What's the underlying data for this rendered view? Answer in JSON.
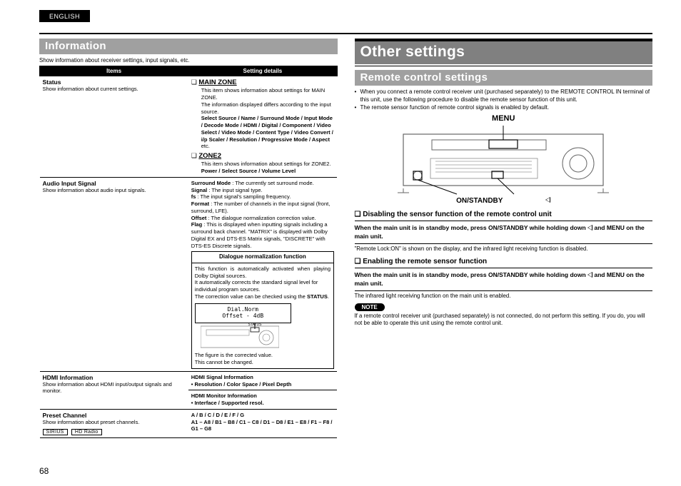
{
  "lang_tab": "ENGLISH",
  "page_number": "68",
  "left": {
    "heading": "Information",
    "intro": "Show information about receiver settings, input signals, etc.",
    "table_head": {
      "col1": "Items",
      "col2": "Setting details"
    },
    "rows": {
      "status": {
        "name": "Status",
        "desc": "Show information about current settings.",
        "mainzone_title": "MAIN ZONE",
        "mainzone_text1": "This item shows information about settings for MAIN ZONE.",
        "mainzone_text2": "The information displayed differs according to the input source.",
        "mainzone_bold": "Select Source / Name / Surround Mode / Input Mode / Decode Mode / HDMI / Digital / Component / Video Select / Video Mode / Content Type / Video Convert / i/p Scaler / Resolution / Progressive Mode / Aspect",
        "mainzone_etc": " etc.",
        "zone2_title": "ZONE2",
        "zone2_text": "This item shows information about settings for ZONE2.",
        "zone2_bold": "Power / Select Source / Volume Level"
      },
      "audio": {
        "name": "Audio Input Signal",
        "desc": "Show information about audio input signals.",
        "l_surround": "Surround Mode",
        "t_surround": " : The currently set surround mode.",
        "l_signal": "Signal",
        "t_signal": " : The input signal type.",
        "l_fs": "fs",
        "t_fs": " : The input signal's sampling frequency.",
        "l_format": "Format",
        "t_format": " : The number of channels in the input signal (front, surround, LFE).",
        "l_offset": "Offset",
        "t_offset": " : The dialogue normalization correction value.",
        "l_flag": "Flag",
        "t_flag": " : This is displayed when inputting signals including a surround back channel. \"MATRIX\" is displayed with Dolby Digital EX and DTS-ES Matrix signals, \"DISCRETE\" with DTS-ES Discrete signals.",
        "dnf_title": "Dialogue normalization function",
        "dnf_p1": "This function is automatically activated when playing Dolby Digital sources.",
        "dnf_p2": "It automatically corrects the standard signal level for individual program sources.",
        "dnf_p3a": "The correction value can be checked using the ",
        "dnf_p3b": "STATUS",
        "dnf_p3c": ".",
        "display_l1": "Dial.Norm",
        "display_l2": "Offset  - 4dB",
        "dnf_fig": "The figure is the corrected value.",
        "dnf_cannot": "This cannot be changed."
      },
      "hdmi": {
        "name": "HDMI Information",
        "desc": "Show information about HDMI input/output signals and monitor.",
        "sig_title": "HDMI Signal Information",
        "sig_line": "• Resolution / Color Space / Pixel Depth",
        "mon_title": "HDMI Monitor Information",
        "mon_line": "• Interface / Supported resol."
      },
      "preset": {
        "name": "Preset Channel",
        "desc": "Show information about preset channels.",
        "line1": "A / B / C / D / E / F / G",
        "line2": "A1 – A8 / B1 – B8 / C1 – C8 / D1 – D8 / E1 – E8 / F1 – F8 / G1 – G8",
        "tag1": "SIRIUS",
        "tag2": "HD Radio"
      }
    }
  },
  "right": {
    "main_heading": "Other settings",
    "sub_heading": "Remote control settings",
    "bullets": {
      "b1": "When you connect a remote control receiver unit (purchased separately) to the REMOTE CONTROL IN terminal of this unit, use the following procedure to disable the remote sensor function of this unit.",
      "b2": "The remote sensor function of remote control signals is enabled by default."
    },
    "menu_label": "MENU",
    "onstandby_label": "ON/STANDBY",
    "h_disable": "Disabling the sensor function of the remote control unit",
    "bar_a": "When the main unit is in standby mode, press ",
    "bar_b": "ON/STANDBY",
    "bar_c": " while holding down ",
    "bar_d": " and ",
    "bar_e": "MENU",
    "bar_f": " on the main unit.",
    "after1": "\"Remote Lock:ON\" is shown on the display, and the infrared light receiving function is disabled.",
    "h_enable": "Enabling the remote sensor function",
    "after2": "The infrared light receiving function on the main unit is enabled.",
    "note_label": "NOTE",
    "note_text": "If a remote control receiver unit (purchased separately) is not connected, do not perform this setting. If you do, you will not be able to operate this unit using the remote control unit."
  }
}
